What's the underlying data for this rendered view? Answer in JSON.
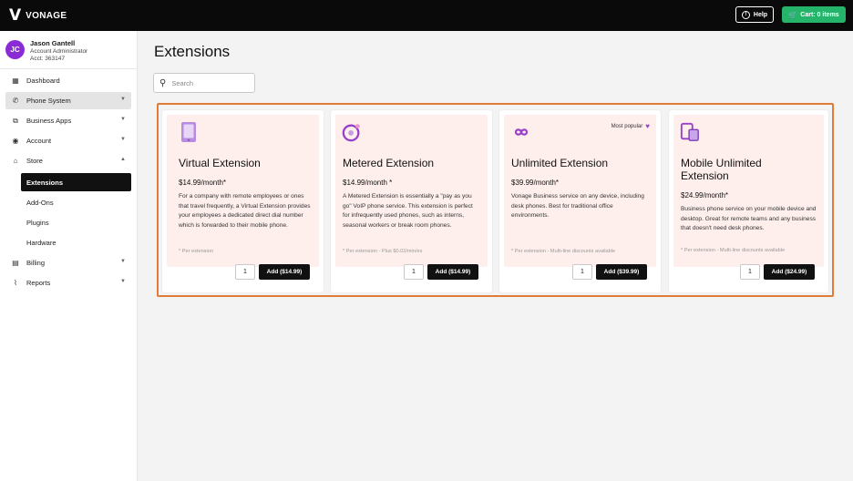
{
  "topbar": {
    "brand": "VONAGE",
    "help_label": "Help",
    "cart_label": "Cart: 0 items"
  },
  "user": {
    "initials": "JC",
    "name": "Jason Gantell",
    "role": "Account Administrator",
    "account": "Acct: 363147"
  },
  "nav": {
    "dashboard": "Dashboard",
    "phone_system": "Phone System",
    "business_apps": "Business Apps",
    "account": "Account",
    "store": "Store",
    "store_items": [
      "Extensions",
      "Add-Ons",
      "Plugins",
      "Hardware"
    ],
    "billing": "Billing",
    "reports": "Reports"
  },
  "page": {
    "title": "Extensions",
    "search_placeholder": "Search"
  },
  "cards": [
    {
      "title": "Virtual Extension",
      "price": "$14.99/month*",
      "description": "For a company with remote employees or ones that travel frequently, a Virtual Extension provides your employees a dedicated direct dial number which is forwarded to their mobile phone.",
      "footnote": "* Per extension",
      "qty": "1",
      "add_label": "Add ($14.99)"
    },
    {
      "title": "Metered Extension",
      "price": "$14.99/month *",
      "description": "A Metered Extension is essentially a \"pay as you go\" VoIP phone service. This extension is perfect for infrequently used phones, such as interns, seasonal workers or break room phones.",
      "footnote": "* Per extension - Plus $0.02/min/ex",
      "qty": "1",
      "add_label": "Add ($14.99)"
    },
    {
      "title": "Unlimited Extension",
      "price": "$39.99/month*",
      "description": "Vonage Business service on any device, including desk phones. Best for traditional office environments.",
      "footnote": "* Per extension - Multi-line discounts available",
      "badge": "Most popular",
      "qty": "1",
      "add_label": "Add ($39.99)"
    },
    {
      "title": "Mobile Unlimited Extension",
      "price": "$24.99/month*",
      "description": "Business phone service on your mobile device and desktop. Great for remote teams and any business that doesn't need desk phones.",
      "footnote": "* Per extension - Multi-line discounts available",
      "qty": "1",
      "add_label": "Add ($24.99)"
    }
  ],
  "colors": {
    "accent_purple": "#8b2bd6",
    "cart_green": "#24b56b",
    "highlight_orange": "#e07b39"
  }
}
